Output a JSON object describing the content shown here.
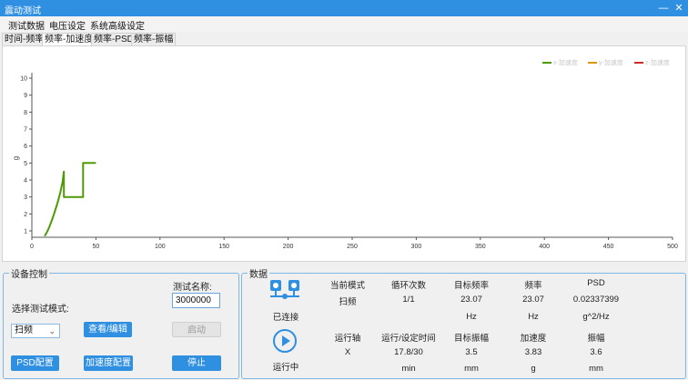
{
  "window": {
    "title": "震动测试",
    "min_glyph": "—",
    "close_glyph": "✕"
  },
  "menu": [
    "测试数据",
    "电压设定",
    "系统高级设定"
  ],
  "tabs": [
    "时间-频率",
    "频率-加速度",
    "频率-PSD",
    "频率-振幅"
  ],
  "active_tab": 1,
  "legend": [
    {
      "label": "x-加速度",
      "color": "#4e9a06"
    },
    {
      "label": "y-加速度",
      "color": "#d99a00"
    },
    {
      "label": "z-加速度",
      "color": "#d62728"
    }
  ],
  "chart_data": {
    "type": "line",
    "ylabel": "g",
    "xlim": [
      0,
      500
    ],
    "ylim": [
      0.5,
      10
    ],
    "xticks": [
      0,
      50,
      100,
      150,
      200,
      250,
      300,
      350,
      400,
      450,
      500
    ],
    "yticks": [
      1,
      2,
      3,
      4,
      5,
      6,
      7,
      8,
      9,
      10
    ],
    "grid": false,
    "legend_position": "top-right",
    "series": [
      {
        "name": "x-加速度",
        "color": "#4e9a06",
        "x": [
          10,
          12,
          14,
          16,
          18,
          20,
          22,
          24,
          25,
          25,
          28,
          32,
          36,
          40,
          40,
          41,
          46,
          50
        ],
        "y": [
          0.7,
          0.95,
          1.3,
          1.7,
          2.15,
          2.65,
          3.2,
          3.9,
          4.5,
          3.0,
          3.0,
          3.0,
          3.0,
          3.0,
          5.0,
          5.0,
          5.0,
          5.0
        ]
      }
    ]
  },
  "device": {
    "legend": "设备控制",
    "test_name_label": "测试名称:",
    "test_name_value": "3000000",
    "mode_label": "选择测试模式:",
    "mode_value": "扫频",
    "view_edit": "查看/编辑",
    "start": "启动",
    "psd_config": "PSD配置",
    "accel_config": "加速度配置",
    "stop": "停止"
  },
  "data_panel": {
    "legend": "数据",
    "connected": "已连接",
    "running": "运行中",
    "row1_headers": [
      "当前模式",
      "循环次数",
      "目标频率",
      "频率",
      "PSD"
    ],
    "row1_values": [
      "扫频",
      "1/1",
      "23.07",
      "23.07",
      "0.02337399"
    ],
    "row1_units": [
      "",
      "",
      "Hz",
      "Hz",
      "g^2/Hz"
    ],
    "row2_headers": [
      "运行轴",
      "运行/设定时间",
      "目标振幅",
      "加速度",
      "振幅"
    ],
    "row2_values": [
      "X",
      "17.8/30",
      "3.5",
      "3.83",
      "3.6"
    ],
    "row2_units": [
      "",
      "min",
      "mm",
      "g",
      "mm"
    ]
  }
}
